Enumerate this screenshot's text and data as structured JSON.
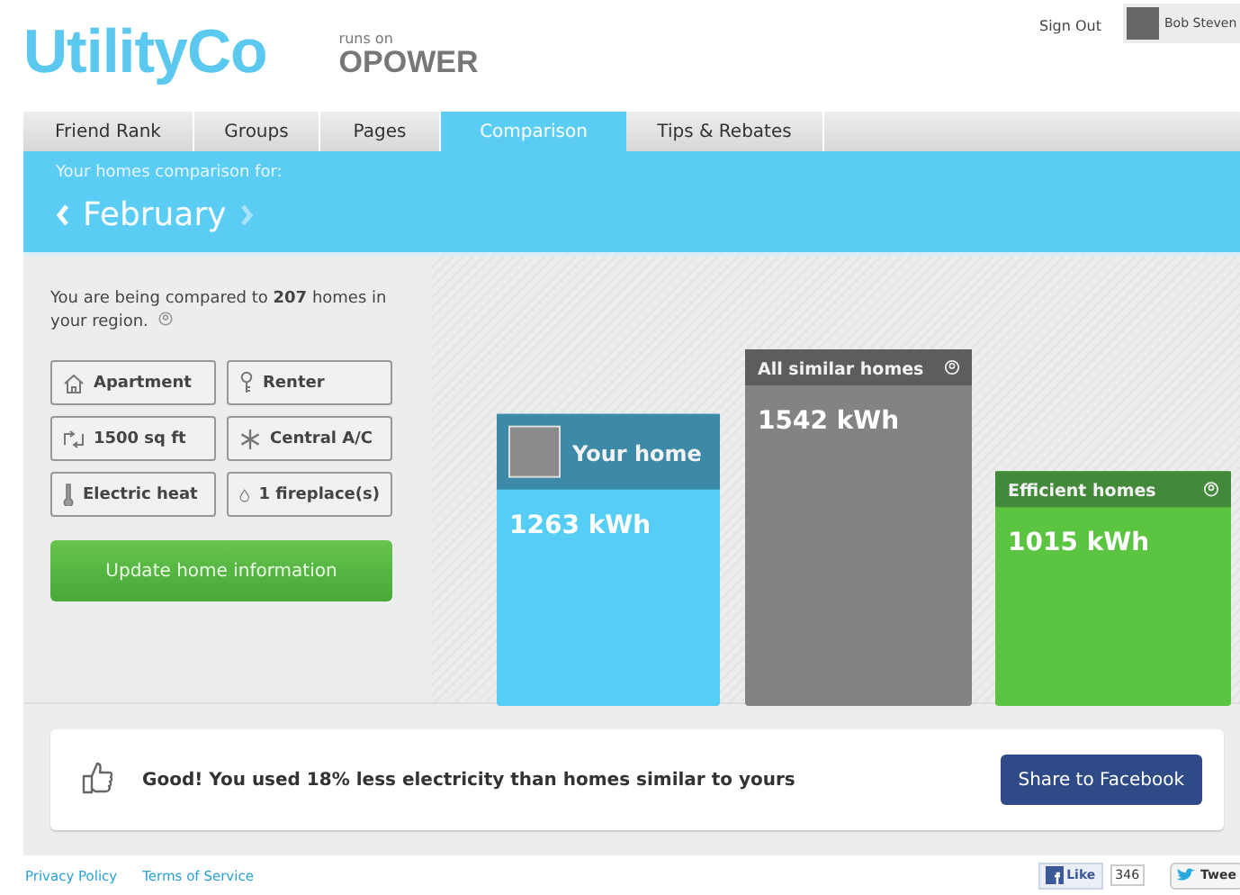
{
  "header": {
    "logo": "UtilityCo",
    "powered_by": {
      "caption": "runs on",
      "brand": "OPOWER"
    },
    "sign_out": "Sign Out",
    "user": {
      "name": "Bob Steven"
    }
  },
  "tabs": [
    {
      "label": "Friend Rank",
      "selected": false
    },
    {
      "label": "Groups",
      "selected": false
    },
    {
      "label": "Pages",
      "selected": false
    },
    {
      "label": "Comparison",
      "selected": true
    },
    {
      "label": "Tips & Rebates",
      "selected": false
    }
  ],
  "period": {
    "caption": "Your homes comparison for:",
    "month": "February"
  },
  "profile": {
    "summary": "You are being compared to **207** homes in your region.",
    "attributes": [
      {
        "kind": "home",
        "label": "Apartment"
      },
      {
        "kind": "key",
        "label": "Renter"
      },
      {
        "kind": "area",
        "label": "1500 sq ft"
      },
      {
        "kind": "snowflake",
        "label": "Central A/C"
      },
      {
        "kind": "thermometer",
        "label": "Electric heat"
      },
      {
        "kind": "drop",
        "label": "1 fireplace(s)"
      }
    ],
    "update_button": "Update home information"
  },
  "comparison": {
    "bars": [
      {
        "kind": "self",
        "label": "Your home",
        "reading": "1263 kWh"
      },
      {
        "kind": "average",
        "label": "All similar homes",
        "reading": "1542 kWh"
      },
      {
        "kind": "efficient",
        "label": "Efficient homes",
        "reading": "1015 kWh"
      }
    ]
  },
  "message": {
    "text": "Good! You used 18% less electricity than homes similar to yours",
    "share_button": "Share to Facebook"
  },
  "footer": {
    "links": [
      "Privacy Policy",
      "Terms of Service"
    ],
    "like": {
      "label": "Like",
      "count": "346"
    },
    "tweet": {
      "label": "Twee"
    }
  }
}
